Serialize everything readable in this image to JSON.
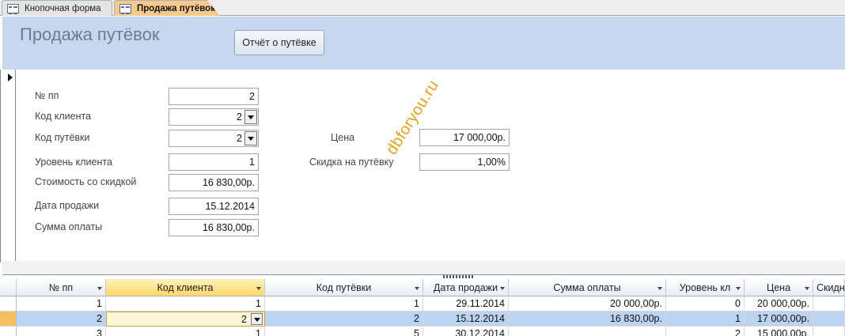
{
  "tabs": [
    {
      "label": "Кнопочная форма"
    },
    {
      "label": "Продажа путёвок"
    }
  ],
  "header": {
    "title": "Продажа путёвок",
    "report_button": "Отчёт о путёвке"
  },
  "form": {
    "num_label": "№ пп",
    "num_value": "2",
    "client_label": "Код клиента",
    "client_value": "2",
    "tour_label": "Код путёвки",
    "tour_value": "2",
    "level_label": "Уровень клиента",
    "level_value": "1",
    "cost_label": "Стоимость со скидкой",
    "cost_value": "16 830,00р.",
    "date_label": "Дата продажи",
    "date_value": "15.12.2014",
    "sum_label": "Сумма оплаты",
    "sum_value": "16 830,00р.",
    "price_label": "Цена",
    "price_value": "17 000,00р.",
    "discount_label": "Скидка на путёвку",
    "discount_value": "1,00%"
  },
  "watermark": "dbforyou.ru",
  "datasheet": {
    "columns": [
      "№ пп",
      "Код клиента",
      "Код путёвки",
      "Дата продажи",
      "Сумма оплаты",
      "Уровень кл",
      "Цена",
      "Скидн"
    ],
    "rows": [
      [
        "1",
        "1",
        "1",
        "29.11.2014",
        "20 000,00р.",
        "0",
        "20 000,00р.",
        ""
      ],
      [
        "2",
        "2",
        "2",
        "15.12.2014",
        "16 830,00р.",
        "1",
        "17 000,00р.",
        ""
      ],
      [
        "3",
        "1",
        "5",
        "30.12.2014",
        "",
        "2",
        "15 000,00р.",
        ""
      ]
    ]
  }
}
